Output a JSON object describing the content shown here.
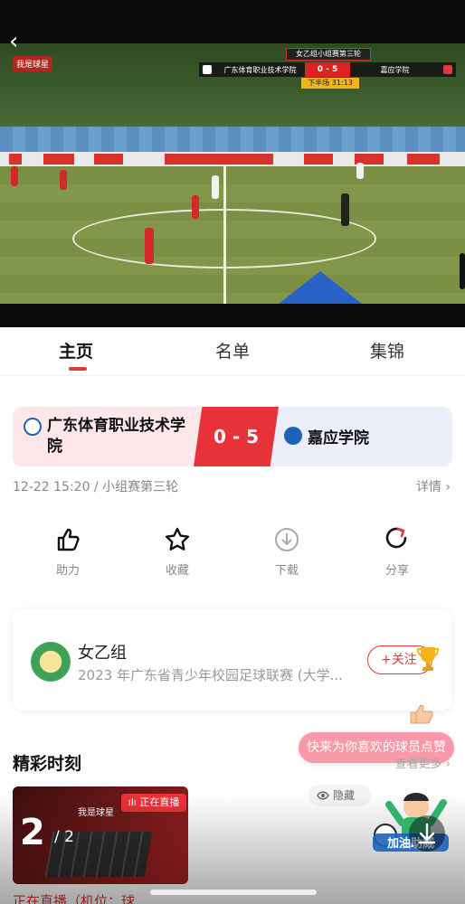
{
  "video": {
    "scoreboard": {
      "round": "女乙组小组赛第三轮",
      "home": "广东体育职业技术学院",
      "score": "0 - 5",
      "away": "嘉应学院",
      "period": "下半场 31:13"
    },
    "watermark": "我是球星"
  },
  "tabs": [
    {
      "label": "主页",
      "active": true
    },
    {
      "label": "名单",
      "active": false
    },
    {
      "label": "集锦",
      "active": false
    }
  ],
  "match": {
    "home": "广东体育职业技术学院",
    "away": "嘉应学院",
    "score": "0 - 5",
    "info": "12-22 15:20 / 小组赛第三轮",
    "details": "详情"
  },
  "actions": [
    {
      "label": "助力",
      "icon": "thumbs-up-icon"
    },
    {
      "label": "收藏",
      "icon": "star-icon"
    },
    {
      "label": "下载",
      "icon": "download-icon"
    },
    {
      "label": "分享",
      "icon": "share-icon"
    }
  ],
  "league": {
    "name": "女乙组",
    "desc": "2023 年广东省青少年校园足球联赛 (大学...",
    "follow": "+关注"
  },
  "highlights": {
    "title": "精彩时刻",
    "more": "查看更多",
    "bubble": "快来为你喜欢的球员点赞",
    "hide": "隐藏",
    "live_chip": "正在直播",
    "thumb_brand": "我是球星",
    "first_item_title": "正在直播（机位：球"
  },
  "pager": {
    "current": "2",
    "total": "/ 2"
  },
  "mascot_text": "加油助威",
  "colors": {
    "accent": "#e8323a",
    "away_blue": "#1e63b8"
  }
}
